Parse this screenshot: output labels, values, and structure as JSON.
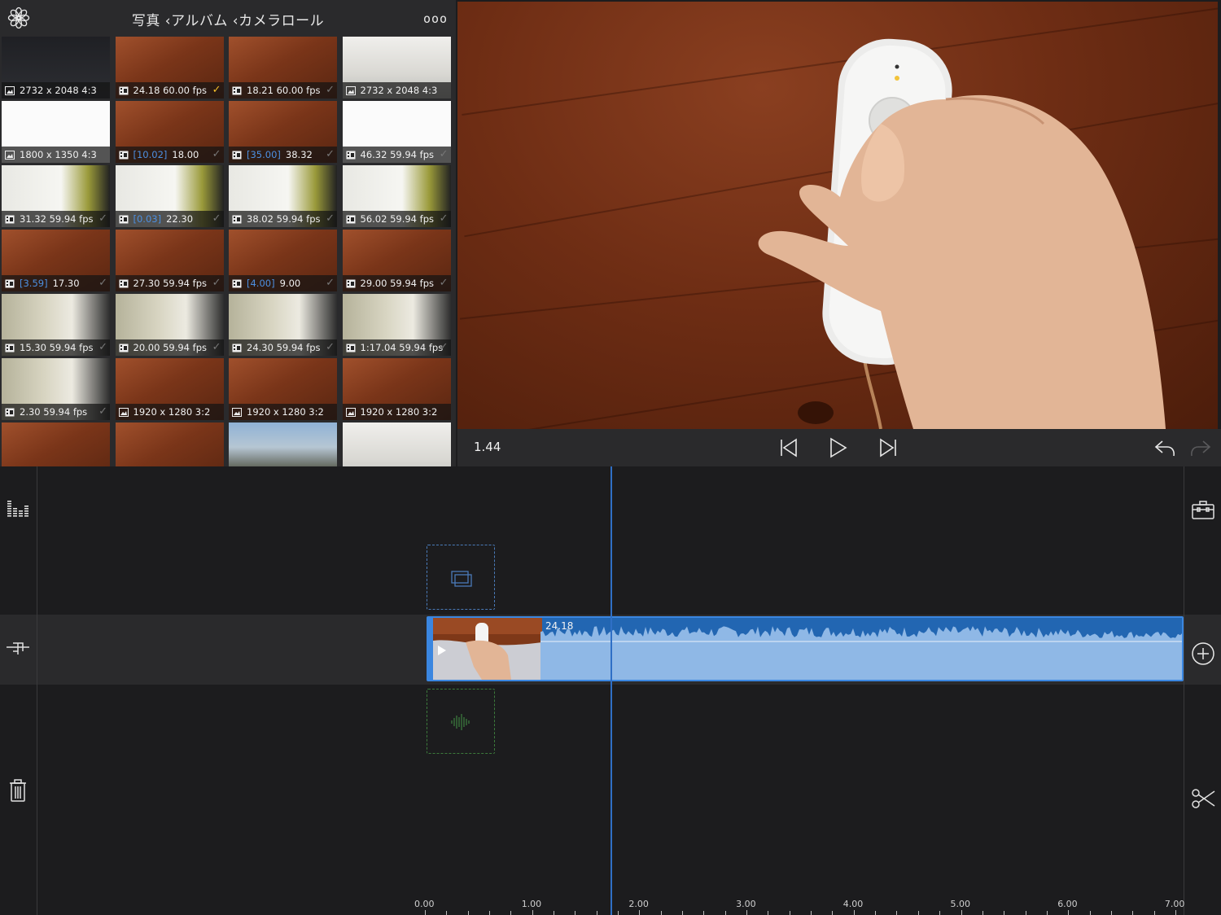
{
  "browser": {
    "breadcrumb": "写真 ‹アルバム ‹カメラロール",
    "more_label": "ooo",
    "tiles": [
      {
        "label": "2732 x 2048  4:3",
        "range": "",
        "kind": "photo",
        "theme": "t-dark",
        "check": false,
        "selected": false
      },
      {
        "label": "24.18  60.00 fps",
        "range": "",
        "kind": "video",
        "theme": "t-wood",
        "check": true,
        "selected": true
      },
      {
        "label": "18.21  60.00 fps",
        "range": "",
        "kind": "video",
        "theme": "t-wood",
        "check": false,
        "selected": false
      },
      {
        "label": "2732 x 2048  4:3",
        "range": "",
        "kind": "photo",
        "theme": "t-person",
        "check": false,
        "selected": false
      },
      {
        "label": "1800 x 1350  4:3",
        "range": "",
        "kind": "photo",
        "theme": "t-white",
        "check": false,
        "selected": false
      },
      {
        "label": "18.00",
        "range": "[10.02]",
        "kind": "video",
        "theme": "t-wood",
        "check": false,
        "selected": false
      },
      {
        "label": "38.32",
        "range": "[35.00]",
        "kind": "video",
        "theme": "t-wood",
        "check": false,
        "selected": false
      },
      {
        "label": "46.32  59.94 fps",
        "range": "",
        "kind": "video",
        "theme": "t-white",
        "check": false,
        "selected": false
      },
      {
        "label": "31.32  59.94 fps",
        "range": "",
        "kind": "video",
        "theme": "t-room",
        "check": false,
        "selected": false
      },
      {
        "label": "22.30",
        "range": "[0.03]",
        "kind": "video",
        "theme": "t-room",
        "check": false,
        "selected": false
      },
      {
        "label": "38.02  59.94 fps",
        "range": "",
        "kind": "video",
        "theme": "t-room",
        "check": false,
        "selected": false
      },
      {
        "label": "56.02  59.94 fps",
        "range": "",
        "kind": "video",
        "theme": "t-room",
        "check": false,
        "selected": false
      },
      {
        "label": "17.30",
        "range": "[3.59]",
        "kind": "video",
        "theme": "t-wood",
        "check": false,
        "selected": false
      },
      {
        "label": "27.30  59.94 fps",
        "range": "",
        "kind": "video",
        "theme": "t-wood",
        "check": false,
        "selected": false
      },
      {
        "label": "9.00",
        "range": "[4.00]",
        "kind": "video",
        "theme": "t-wood",
        "check": false,
        "selected": false
      },
      {
        "label": "29.00  59.94 fps",
        "range": "",
        "kind": "video",
        "theme": "t-wood",
        "check": false,
        "selected": false
      },
      {
        "label": "15.30  59.94 fps",
        "range": "",
        "kind": "video",
        "theme": "t-room2",
        "check": false,
        "selected": false
      },
      {
        "label": "20.00  59.94 fps",
        "range": "",
        "kind": "video",
        "theme": "t-room2",
        "check": false,
        "selected": false
      },
      {
        "label": "24.30  59.94 fps",
        "range": "",
        "kind": "video",
        "theme": "t-room2",
        "check": false,
        "selected": false
      },
      {
        "label": "1:17.04  59.94 fps",
        "range": "",
        "kind": "video",
        "theme": "t-room2",
        "check": false,
        "selected": false
      },
      {
        "label": "2.30  59.94 fps",
        "range": "",
        "kind": "video",
        "theme": "t-room2",
        "check": false,
        "selected": false
      },
      {
        "label": "1920 x 1280  3:2",
        "range": "",
        "kind": "photo",
        "theme": "t-wood",
        "check": false,
        "selected": false
      },
      {
        "label": "1920 x 1280  3:2",
        "range": "",
        "kind": "photo",
        "theme": "t-wood",
        "check": false,
        "selected": false
      },
      {
        "label": "1920 x 1280  3:2",
        "range": "",
        "kind": "photo",
        "theme": "t-wood",
        "check": false,
        "selected": false
      },
      {
        "label": "",
        "range": "",
        "kind": "none",
        "theme": "t-wood",
        "check": false,
        "selected": false
      },
      {
        "label": "",
        "range": "",
        "kind": "none",
        "theme": "t-wood",
        "check": false,
        "selected": false
      },
      {
        "label": "",
        "range": "",
        "kind": "none",
        "theme": "t-street",
        "check": false,
        "selected": false
      },
      {
        "label": "",
        "range": "",
        "kind": "none",
        "theme": "t-person",
        "check": false,
        "selected": false
      }
    ]
  },
  "transport": {
    "time": "1.44",
    "icons": [
      "skip-back-icon",
      "play-icon",
      "skip-forward-icon",
      "undo-icon",
      "redo-icon"
    ]
  },
  "timeline": {
    "clip_label": "24.18",
    "ruler_labels": [
      "0.00",
      "1.00",
      "2.00",
      "3.00",
      "4.00",
      "5.00",
      "6.00",
      "7.00"
    ],
    "left_icons": [
      "audio-levels-icon",
      "transition-icon",
      "trash-icon"
    ],
    "right_icons": [
      "toolbox-icon",
      "add-icon",
      "scissors-icon"
    ]
  },
  "colors": {
    "accent": "#3a86e0",
    "selection": "#f5c02a",
    "clip": "#2266b2",
    "range_text": "#4c8fe0"
  }
}
